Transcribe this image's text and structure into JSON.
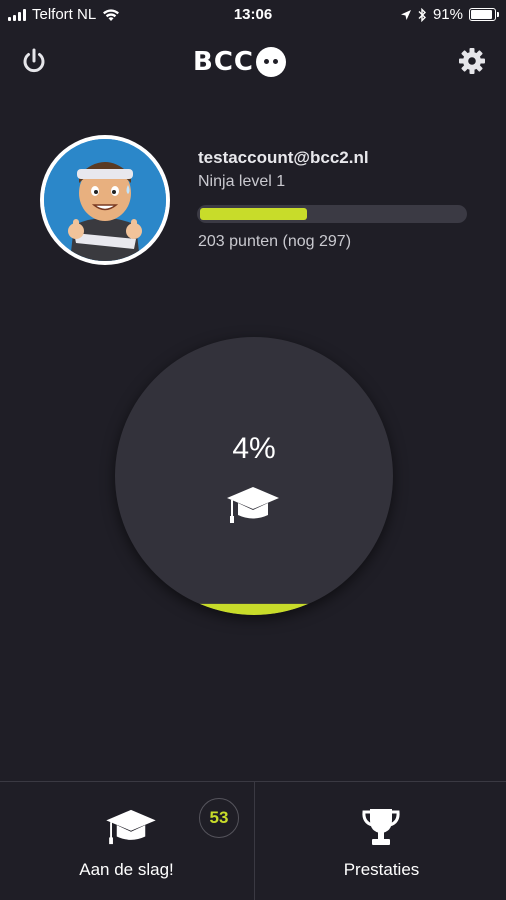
{
  "status_bar": {
    "carrier": "Telfort NL",
    "time": "13:06",
    "battery_percent": "91%"
  },
  "header": {
    "logo_text": "BCC",
    "power_icon": "power-icon",
    "settings_icon": "gear-icon"
  },
  "profile": {
    "email": "testaccount@bcc2.nl",
    "level": "Ninja level 1",
    "points_text": "203 punten (nog 297)",
    "progress_fraction": 0.406,
    "accent_color": "#c8dc2a"
  },
  "progress_circle": {
    "percent_text": "4%",
    "percent_value": 4,
    "icon": "graduation-cap-icon"
  },
  "bottom_nav": {
    "items": [
      {
        "label": "Aan de slag!",
        "icon": "graduation-cap-icon",
        "badge": "53"
      },
      {
        "label": "Prestaties",
        "icon": "trophy-icon"
      }
    ]
  }
}
